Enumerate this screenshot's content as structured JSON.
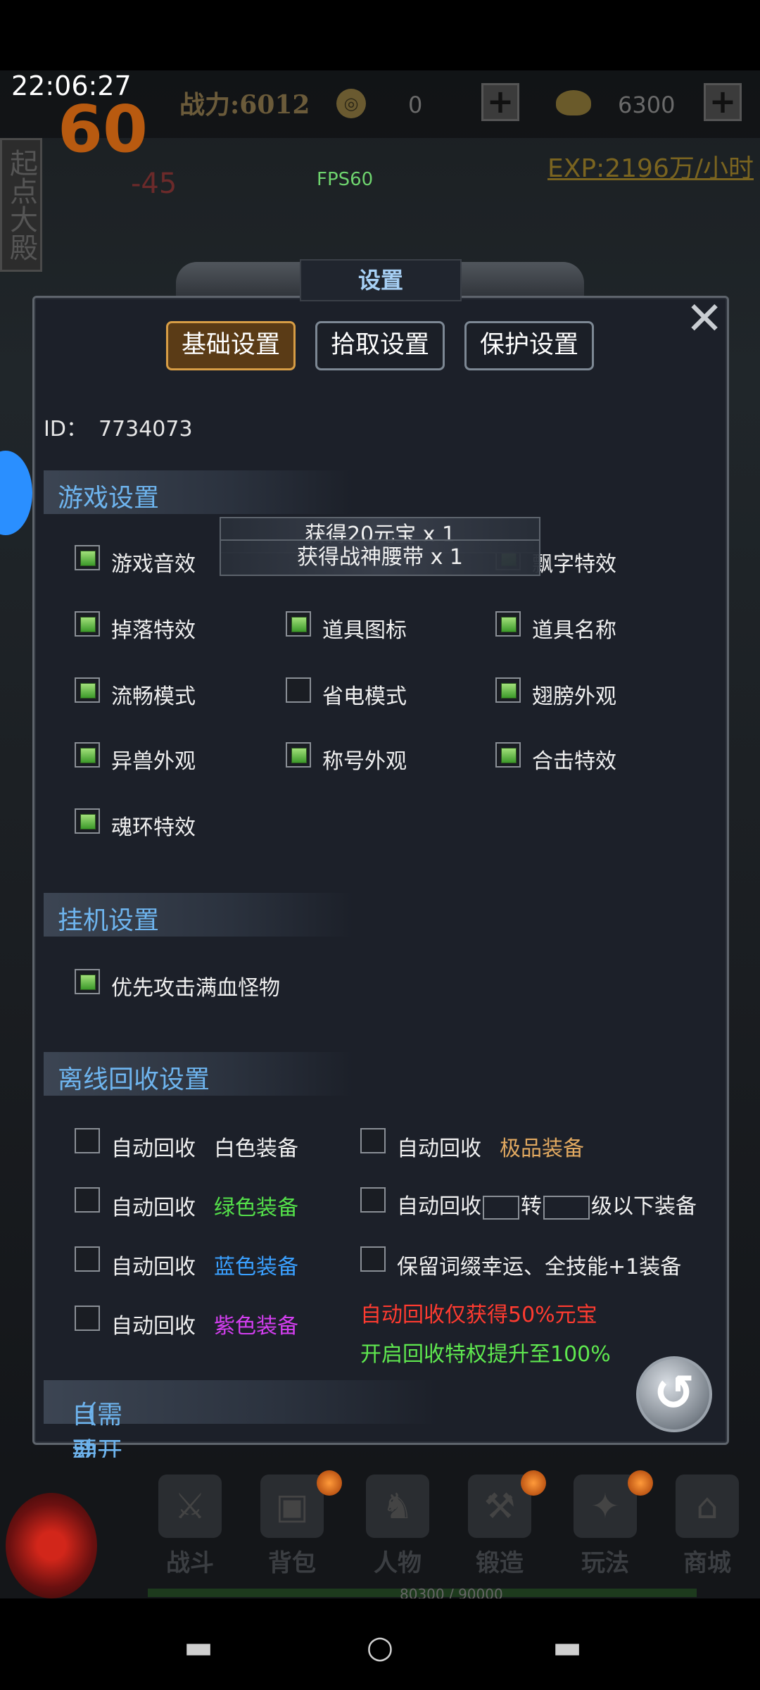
{
  "status": {
    "clock": "22:06:27",
    "fps_big": "60",
    "fps_small": "FPS60"
  },
  "resources": {
    "power": "战力:6012",
    "coin_icon": "coin-icon",
    "coin_value": "0",
    "ingot_value": "6300",
    "plus": "+",
    "exp": "EXP:2196万/小时",
    "side_tab": "起点大殿",
    "damage": "-45"
  },
  "dialog": {
    "title": "设置",
    "close": "✕",
    "tabs": [
      {
        "label": "基础设置",
        "active": true
      },
      {
        "label": "拾取设置",
        "active": false
      },
      {
        "label": "保护设置",
        "active": false
      }
    ],
    "id_label": "ID：",
    "id_value": "7734073",
    "sections": {
      "game": "游戏设置",
      "idle": "挂机设置",
      "offline": "离线回收设置",
      "auto_use": "自动使用",
      "auto_use_note": "（需要开通战神特权）"
    },
    "game_settings": [
      {
        "label": "游戏音效",
        "checked": true
      },
      {
        "label": "飘字特效",
        "checked": true
      },
      {
        "label": "掉落特效",
        "checked": true
      },
      {
        "label": "道具图标",
        "checked": true
      },
      {
        "label": "道具名称",
        "checked": true
      },
      {
        "label": "流畅模式",
        "checked": true
      },
      {
        "label": "省电模式",
        "checked": false
      },
      {
        "label": "翅膀外观",
        "checked": true
      },
      {
        "label": "异兽外观",
        "checked": true
      },
      {
        "label": "称号外观",
        "checked": true
      },
      {
        "label": "合击特效",
        "checked": true
      },
      {
        "label": "魂环特效",
        "checked": true
      }
    ],
    "idle_settings": [
      {
        "label": "优先攻击满血怪物",
        "checked": true
      }
    ],
    "offline": {
      "auto_recycle": "自动回收",
      "white": "白色装备",
      "green": "绿色装备",
      "blue": "蓝色装备",
      "purple": "紫色装备",
      "best": "极品装备",
      "turn": "转",
      "level_below": "级以下装备",
      "keep_affix": "保留词缀幸运、全技能+1装备",
      "note_red": "自动回收仅获得50%元宝",
      "note_green": "开启回收特权提升至100%"
    },
    "toasts": [
      "获得20元宝 x 1",
      "获得战神腰带 x 1"
    ],
    "back_icon": "↺"
  },
  "nav": {
    "items": [
      "战斗",
      "背包",
      "人物",
      "锻造",
      "玩法",
      "商城"
    ],
    "hp": "80300 / 90000"
  },
  "colors": {
    "accent_blue": "#6eb4ee",
    "active_tab": "#d79d45",
    "red_note": "#ff3b30",
    "green_note": "#5fe84f"
  }
}
